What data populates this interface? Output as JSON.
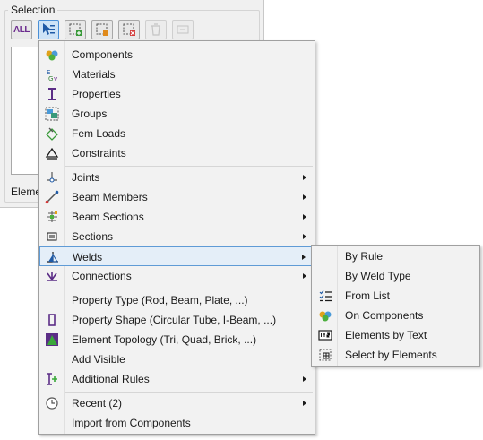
{
  "selection_panel": {
    "group_title": "Selection",
    "all_button_label": "ALL",
    "element_label": "Eleme",
    "toolbar": [
      {
        "name": "select-all-button",
        "icon": "all-icon"
      },
      {
        "name": "select-cursor-button",
        "icon": "select-cursor-icon",
        "active": true
      },
      {
        "name": "select-add-button",
        "icon": "select-add-icon"
      },
      {
        "name": "select-filter-button",
        "icon": "select-filter-icon"
      },
      {
        "name": "select-remove-button",
        "icon": "select-remove-icon"
      },
      {
        "name": "delete-button",
        "icon": "trash-icon",
        "disabled": true
      },
      {
        "name": "edit-button",
        "icon": "edit-icon",
        "disabled": true
      }
    ]
  },
  "main_menu": {
    "items": [
      {
        "label": "Components",
        "icon": "components-icon"
      },
      {
        "label": "Materials",
        "icon": "materials-icon"
      },
      {
        "label": "Properties",
        "icon": "properties-icon"
      },
      {
        "label": "Groups",
        "icon": "groups-icon"
      },
      {
        "label": "Fem Loads",
        "icon": "fem-loads-icon"
      },
      {
        "label": "Constraints",
        "icon": "constraints-icon"
      },
      {
        "label": "Joints",
        "icon": "joints-icon",
        "submenu": true
      },
      {
        "label": "Beam Members",
        "icon": "beam-members-icon",
        "submenu": true
      },
      {
        "label": "Beam Sections",
        "icon": "beam-sections-icon",
        "submenu": true
      },
      {
        "label": "Sections",
        "icon": "sections-icon",
        "submenu": true
      },
      {
        "label": "Welds",
        "icon": "welds-icon",
        "submenu": true,
        "highlighted": true
      },
      {
        "label": "Connections",
        "icon": "connections-icon",
        "submenu": true
      },
      {
        "label": "Property Type (Rod, Beam, Plate, ...)",
        "icon": ""
      },
      {
        "label": "Property Shape (Circular Tube, I-Beam, ...)",
        "icon": "property-shape-icon"
      },
      {
        "label": "Element Topology (Tri, Quad, Brick, ...)",
        "icon": "element-topology-icon"
      },
      {
        "label": "Add Visible",
        "icon": ""
      },
      {
        "label": "Additional Rules",
        "icon": "additional-rules-icon",
        "submenu": true
      },
      {
        "label": "Recent (2)",
        "icon": "clock-icon",
        "submenu": true
      },
      {
        "label": "Import from Components",
        "icon": ""
      }
    ]
  },
  "welds_submenu": {
    "items": [
      {
        "label": "By Rule",
        "icon": ""
      },
      {
        "label": "By Weld Type",
        "icon": ""
      },
      {
        "label": "From List",
        "icon": "list-icon"
      },
      {
        "label": "On Components",
        "icon": "components-icon"
      },
      {
        "label": "Elements by Text",
        "icon": "text-box-icon"
      },
      {
        "label": "Select by Elements",
        "icon": "select-elements-icon"
      }
    ]
  },
  "colors": {
    "highlight_fill": "#e4eef8",
    "highlight_border": "#5f9bd6",
    "menu_bg": "#f2f2f2",
    "icon_blue": "#1f5aa6",
    "icon_purple": "#5b2d86"
  }
}
